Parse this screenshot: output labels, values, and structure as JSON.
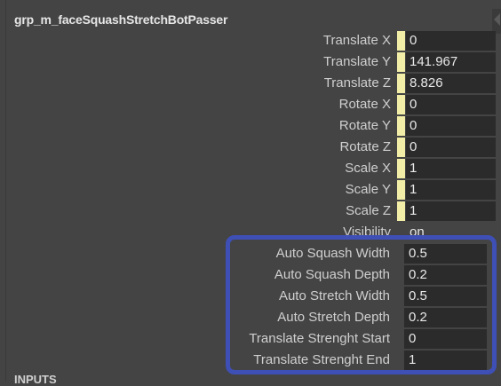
{
  "node": {
    "title": "grp_m_faceSquashStretchBotPasser"
  },
  "transform_attributes": [
    {
      "label": "Translate X",
      "value": "0"
    },
    {
      "label": "Translate Y",
      "value": "141.967"
    },
    {
      "label": "Translate Z",
      "value": "8.826"
    },
    {
      "label": "Rotate X",
      "value": "0"
    },
    {
      "label": "Rotate Y",
      "value": "0"
    },
    {
      "label": "Rotate Z",
      "value": "0"
    },
    {
      "label": "Scale X",
      "value": "1"
    },
    {
      "label": "Scale Y",
      "value": "1"
    },
    {
      "label": "Scale Z",
      "value": "1"
    },
    {
      "label": "Visibility",
      "value": "on"
    }
  ],
  "custom_attributes": [
    {
      "label": "Auto Squash Width",
      "value": "0.5"
    },
    {
      "label": "Auto Squash Depth",
      "value": "0.2"
    },
    {
      "label": "Auto Stretch Width",
      "value": "0.5"
    },
    {
      "label": "Auto Stretch Depth",
      "value": "0.2"
    },
    {
      "label": "Translate Strenght Start",
      "value": "0"
    },
    {
      "label": "Translate Strenght End",
      "value": "1"
    }
  ],
  "section": {
    "inputs_label": "INPUTS"
  },
  "colors": {
    "panel_bg": "#444444",
    "field_bg": "#2b2b2b",
    "keyed_swatch": "#f2eea7",
    "highlight": "#3e4fb6"
  }
}
